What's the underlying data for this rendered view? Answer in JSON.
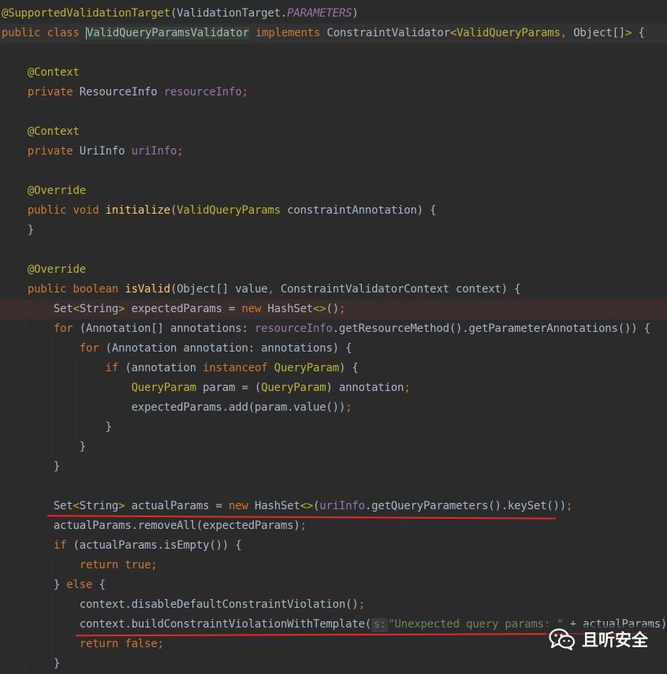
{
  "code_lines": [
    {
      "spans": [
        [
          "a",
          "@SupportedValidationTarget"
        ],
        [
          "t",
          "(ValidationTarget."
        ],
        [
          "pi",
          "PARAMETERS"
        ],
        [
          "t",
          ")"
        ]
      ]
    },
    {
      "spans": [
        [
          "k",
          "public class "
        ],
        [
          "sel",
          "ValidQueryParamsValidator"
        ],
        [
          "t",
          " "
        ],
        [
          "k",
          "implements "
        ],
        [
          "t",
          "ConstraintValidator"
        ],
        [
          "a",
          "<"
        ],
        [
          "a",
          "ValidQueryParams"
        ],
        [
          "punc",
          ", "
        ],
        [
          "t",
          "Object[]"
        ],
        [
          "a",
          ">"
        ],
        [
          "t",
          " {"
        ]
      ]
    },
    {
      "spans": []
    },
    {
      "spans": [
        [
          "t",
          "    "
        ],
        [
          "a",
          "@Context"
        ]
      ]
    },
    {
      "spans": [
        [
          "t",
          "    "
        ],
        [
          "k",
          "private "
        ],
        [
          "t",
          "ResourceInfo "
        ],
        [
          "p",
          "resourceInfo"
        ],
        [
          "punc",
          ";"
        ]
      ]
    },
    {
      "spans": []
    },
    {
      "spans": [
        [
          "t",
          "    "
        ],
        [
          "a",
          "@Context"
        ]
      ]
    },
    {
      "spans": [
        [
          "t",
          "    "
        ],
        [
          "k",
          "private "
        ],
        [
          "t",
          "UriInfo "
        ],
        [
          "p",
          "uriInfo"
        ],
        [
          "punc",
          ";"
        ]
      ]
    },
    {
      "spans": []
    },
    {
      "spans": [
        [
          "t",
          "    "
        ],
        [
          "a",
          "@Override"
        ]
      ]
    },
    {
      "spans": [
        [
          "t",
          "    "
        ],
        [
          "k",
          "public void "
        ],
        [
          "f",
          "initialize"
        ],
        [
          "t",
          "("
        ],
        [
          "a",
          "ValidQueryParams"
        ],
        [
          "t",
          " constraintAnnotation) {"
        ]
      ]
    },
    {
      "spans": [
        [
          "t",
          "    }"
        ]
      ]
    },
    {
      "spans": []
    },
    {
      "spans": [
        [
          "t",
          "    "
        ],
        [
          "a",
          "@Override"
        ]
      ]
    },
    {
      "spans": [
        [
          "t",
          "    "
        ],
        [
          "k",
          "public boolean "
        ],
        [
          "f",
          "isValid"
        ],
        [
          "t",
          "(Object[] value"
        ],
        [
          "punc",
          ", "
        ],
        [
          "t",
          "ConstraintValidatorContext context) {"
        ]
      ]
    },
    {
      "spans": [
        [
          "t",
          "        Set"
        ],
        [
          "a",
          "<"
        ],
        [
          "t",
          "String"
        ],
        [
          "a",
          ">"
        ],
        [
          "t",
          " expectedParams = "
        ],
        [
          "k",
          "new "
        ],
        [
          "t",
          "HashSet"
        ],
        [
          "a",
          "<>"
        ],
        [
          "t",
          "()"
        ],
        [
          "punc",
          ";"
        ]
      ]
    },
    {
      "spans": [
        [
          "t",
          "        "
        ],
        [
          "k",
          "for "
        ],
        [
          "t",
          "(Annotation[] annotations: "
        ],
        [
          "p",
          "resourceInfo"
        ],
        [
          "t",
          ".getResourceMethod().getParameterAnnotations()) {"
        ]
      ]
    },
    {
      "spans": [
        [
          "t",
          "            "
        ],
        [
          "k",
          "for "
        ],
        [
          "t",
          "(Annotation annotation: annotations) {"
        ]
      ]
    },
    {
      "spans": [
        [
          "t",
          "                "
        ],
        [
          "k",
          "if "
        ],
        [
          "t",
          "(annotation "
        ],
        [
          "k",
          "instanceof "
        ],
        [
          "a",
          "QueryParam"
        ],
        [
          "t",
          ") {"
        ]
      ]
    },
    {
      "spans": [
        [
          "t",
          "                    "
        ],
        [
          "a",
          "QueryParam"
        ],
        [
          "t",
          " param = ("
        ],
        [
          "a",
          "QueryParam"
        ],
        [
          "t",
          ") annotation"
        ],
        [
          "punc",
          ";"
        ]
      ]
    },
    {
      "spans": [
        [
          "t",
          "                    expectedParams.add(param.value())"
        ],
        [
          "punc",
          ";"
        ]
      ]
    },
    {
      "spans": [
        [
          "t",
          "                }"
        ]
      ]
    },
    {
      "spans": [
        [
          "t",
          "            }"
        ]
      ]
    },
    {
      "spans": [
        [
          "t",
          "        }"
        ]
      ]
    },
    {
      "spans": []
    },
    {
      "spans": [
        [
          "t",
          "        Set"
        ],
        [
          "a",
          "<"
        ],
        [
          "t",
          "String"
        ],
        [
          "a",
          ">"
        ],
        [
          "t",
          " actualParams = "
        ],
        [
          "k",
          "new "
        ],
        [
          "t",
          "HashSet"
        ],
        [
          "a",
          "<>"
        ],
        [
          "t",
          "("
        ],
        [
          "p",
          "uriInfo"
        ],
        [
          "t",
          ".getQueryParameters().keySet())"
        ],
        [
          "punc",
          ";"
        ]
      ]
    },
    {
      "spans": [
        [
          "t",
          "        actualParams.removeAll(expectedParams)"
        ],
        [
          "punc",
          ";"
        ]
      ]
    },
    {
      "spans": [
        [
          "t",
          "        "
        ],
        [
          "k",
          "if "
        ],
        [
          "t",
          "(actualParams.isEmpty()) {"
        ]
      ]
    },
    {
      "spans": [
        [
          "t",
          "            "
        ],
        [
          "k",
          "return true"
        ],
        [
          "punc",
          ";"
        ]
      ]
    },
    {
      "spans": [
        [
          "t",
          "        } "
        ],
        [
          "k",
          "else "
        ],
        [
          "t",
          "{"
        ]
      ]
    },
    {
      "spans": [
        [
          "t",
          "            context.disableDefaultConstraintViolation()"
        ],
        [
          "punc",
          ";"
        ]
      ]
    },
    {
      "spans": [
        [
          "t",
          "            context.buildConstraintViolationWithTemplate("
        ],
        [
          "hint",
          "s:"
        ],
        [
          "s",
          "\"Unexpected query params: \""
        ],
        [
          "t",
          " + actualParams).ad"
        ]
      ]
    },
    {
      "spans": [
        [
          "t",
          "            "
        ],
        [
          "k",
          "return false"
        ],
        [
          "punc",
          ";"
        ]
      ]
    },
    {
      "spans": [
        [
          "t",
          "        }"
        ]
      ]
    }
  ],
  "watermark": {
    "text": "且听安全",
    "icon": "wechat-icon"
  },
  "colors": {
    "background": "#2b2b2b",
    "keyword": "#cc7832",
    "annotation": "#bbb529",
    "method": "#ffc66d",
    "field": "#9876aa",
    "string": "#6a8759",
    "underline": "#e32b2b"
  }
}
